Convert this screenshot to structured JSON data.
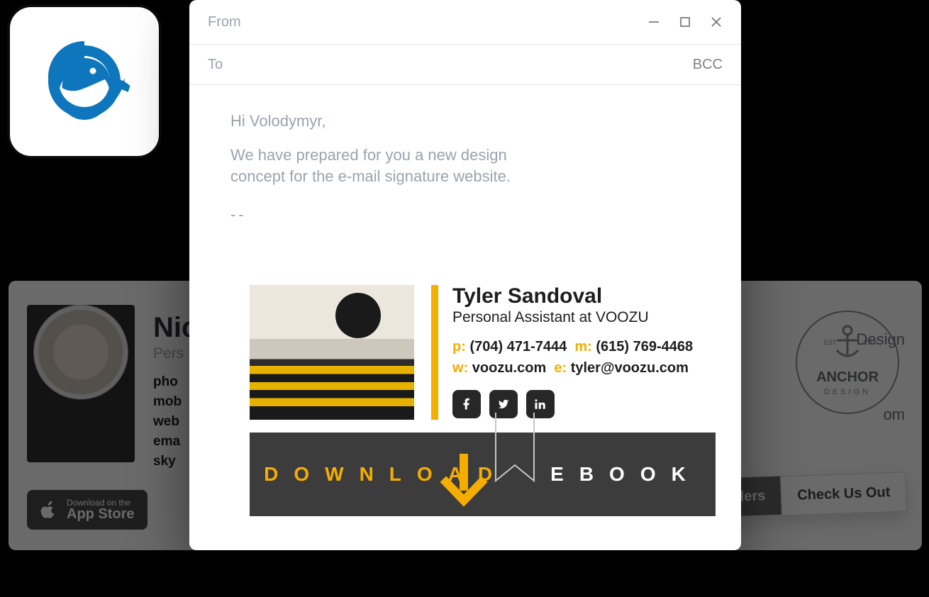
{
  "app_tile": {
    "name": "Mailbird"
  },
  "compose": {
    "from_label": "From",
    "to_label": "To",
    "bcc_label": "BCC",
    "body_greeting": "Hi Volodymyr,",
    "body_text": "We have prepared for you a new design concept for the e-mail signature website.",
    "divider": "--"
  },
  "signature": {
    "name": "Tyler Sandoval",
    "role": "Personal Assistant at VOOZU",
    "phone_key": "p:",
    "phone_val": "(704) 471-7444",
    "mobile_key": "m:",
    "mobile_val": "(615) 769-4468",
    "web_key": "w:",
    "web_val": "voozu.com",
    "email_key": "e:",
    "email_val": "tyler@voozu.com",
    "socials": [
      "facebook",
      "twitter",
      "linkedin"
    ]
  },
  "banner": {
    "left_word": "DOWNLOAD",
    "right_word": "EBOOK"
  },
  "bg_left": {
    "name_partial": "Nic",
    "role_partial": "Pers",
    "label_phone": "pho",
    "label_mobile": "mob",
    "label_web": "web",
    "label_email": "ema",
    "label_skype": "sky",
    "appstore_top": "Download on the",
    "appstore_bottom": "App Store"
  },
  "bg_right": {
    "business": "Design",
    "domain_tail": "om",
    "logo_top": "EST.",
    "logo_year": "2019",
    "logo_name": "ANCHOR",
    "logo_sub": "DESIGN",
    "btn_dark_partial": "ders",
    "btn_light": "Check Us Out"
  }
}
